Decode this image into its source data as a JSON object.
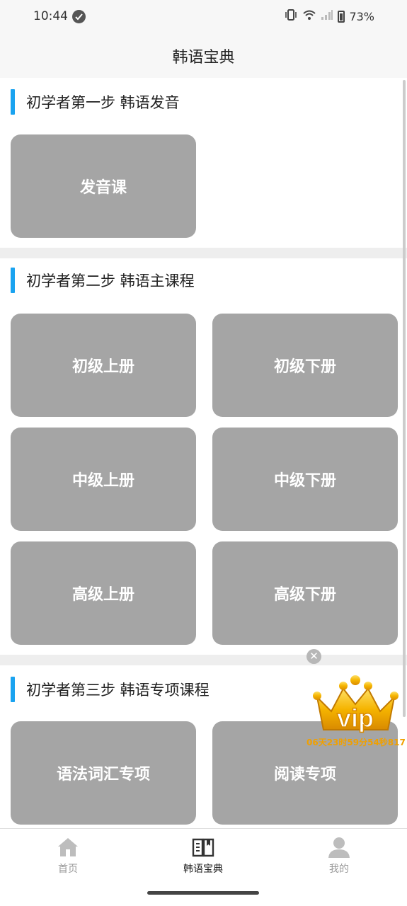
{
  "status": {
    "time": "10:44",
    "battery": "73%"
  },
  "header": {
    "title": "韩语宝典"
  },
  "sections": [
    {
      "title": "初学者第一步 韩语发音",
      "cards": [
        "发音课"
      ]
    },
    {
      "title": "初学者第二步 韩语主课程",
      "cards": [
        "初级上册",
        "初级下册",
        "中级上册",
        "中级下册",
        "高级上册",
        "高级下册"
      ]
    },
    {
      "title": "初学者第三步 韩语专项课程",
      "cards": [
        "语法词汇专项",
        "阅读专项"
      ]
    }
  ],
  "vip": {
    "badge_text": "vip",
    "countdown": "06天23时59分54秒817",
    "close_icon": "close-icon"
  },
  "tabs": [
    {
      "label": "首页",
      "icon": "home-icon",
      "active": false
    },
    {
      "label": "韩语宝典",
      "icon": "book-icon",
      "active": true
    },
    {
      "label": "我的",
      "icon": "user-icon",
      "active": false
    }
  ],
  "colors": {
    "accent": "#1aa3f0",
    "card": "#a5a5a5",
    "vip": "#f0a000"
  }
}
